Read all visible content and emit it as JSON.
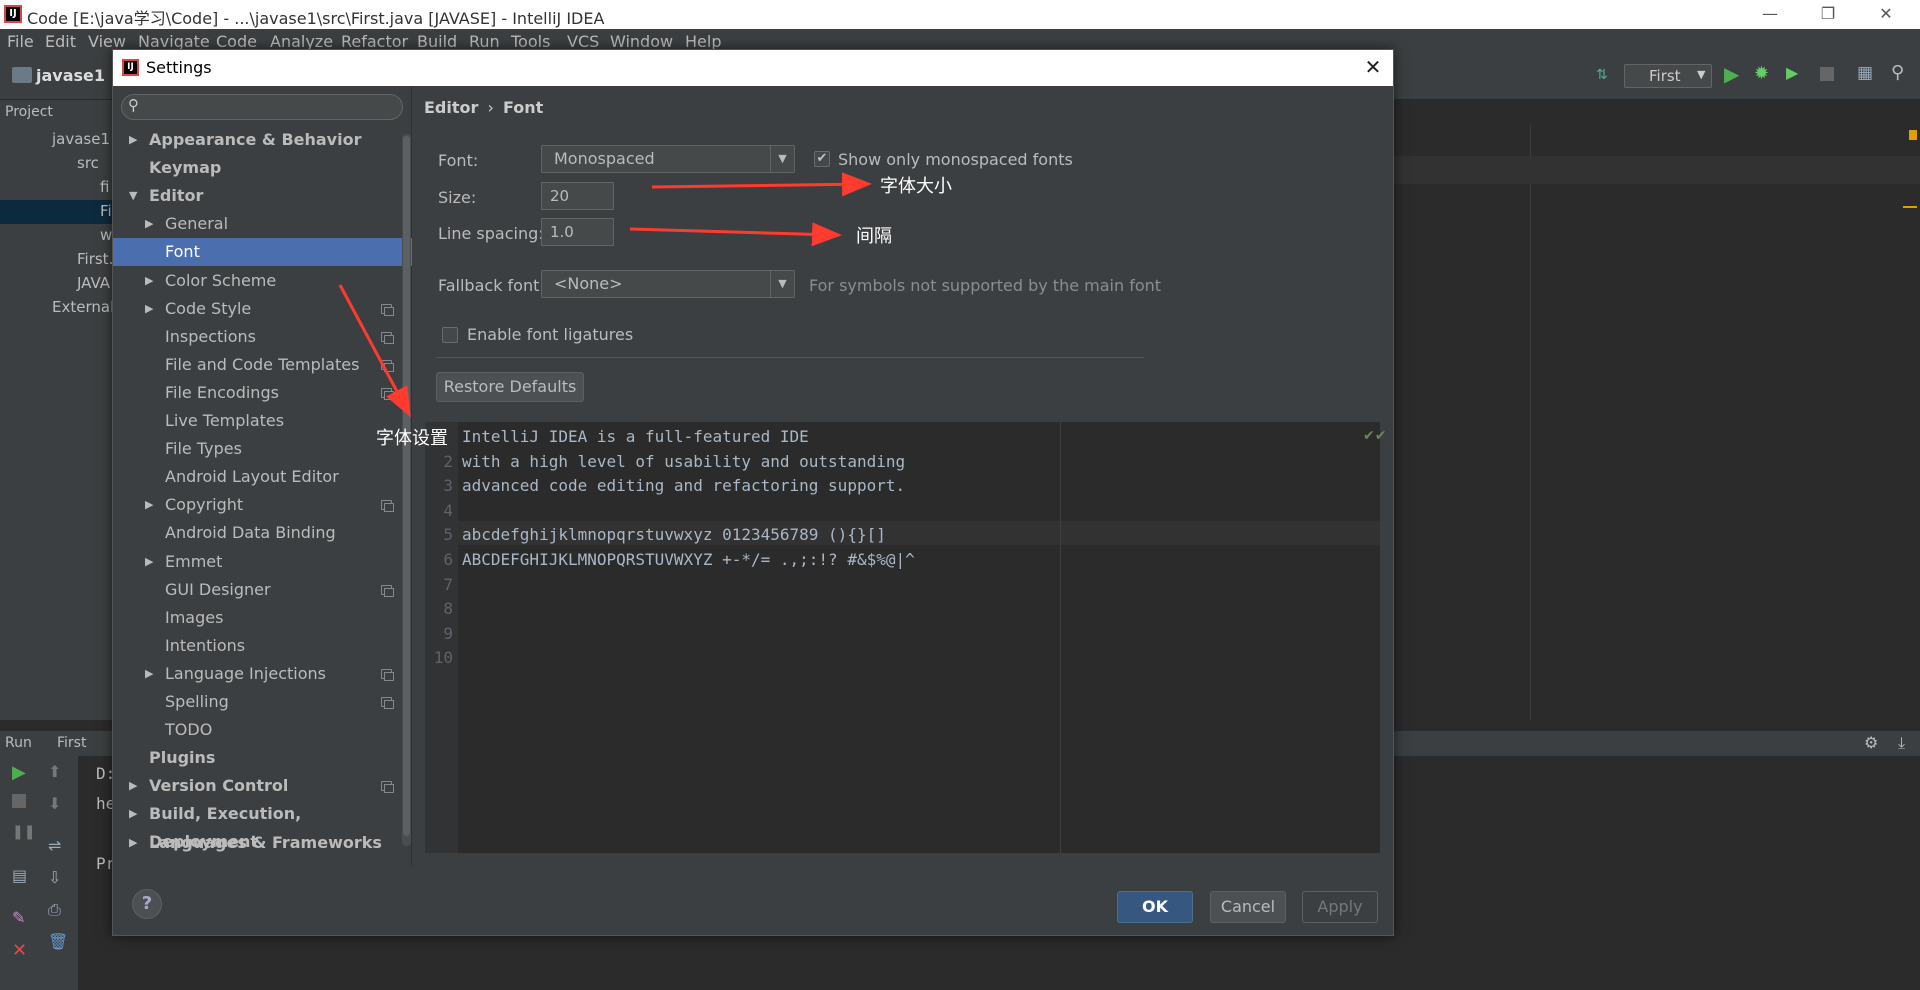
{
  "window": {
    "title": "Code [E:\\java学习\\Code] - ...\\javase1\\src\\First.java [JAVASE] - IntelliJ IDEA"
  },
  "menu": [
    "File",
    "Edit",
    "View",
    "Navigate",
    "Code",
    "Analyze",
    "Refactor",
    "Build",
    "Run",
    "Tools",
    "VCS",
    "Window",
    "Help"
  ],
  "toolbar": {
    "project": "javase1",
    "run_config": "First"
  },
  "project_panel": {
    "tab": "Project",
    "items": [
      "javase1",
      "src",
      "fi",
      "Fi",
      "w",
      "First.",
      "JAVA",
      "External"
    ]
  },
  "run_panel": {
    "label": "Run",
    "config": "First",
    "lines": [
      "D:",
      "he",
      "Pr"
    ]
  },
  "dialog": {
    "title": "Settings",
    "search": {
      "placeholder": ""
    },
    "breadcrumb": {
      "parent": "Editor",
      "sep": "›",
      "current": "Font"
    },
    "tree": [
      {
        "label": "Appearance & Behavior",
        "level": 0,
        "bold": true,
        "arrow": "▶"
      },
      {
        "label": "Keymap",
        "level": 0,
        "bold": true,
        "arrow": ""
      },
      {
        "label": "Editor",
        "level": 0,
        "bold": true,
        "arrow": "▼"
      },
      {
        "label": "General",
        "level": 1,
        "arrow": "▶"
      },
      {
        "label": "Font",
        "level": 1,
        "arrow": "",
        "selected": true
      },
      {
        "label": "Color Scheme",
        "level": 1,
        "arrow": "▶"
      },
      {
        "label": "Code Style",
        "level": 1,
        "arrow": "▶",
        "copy": true
      },
      {
        "label": "Inspections",
        "level": 1,
        "arrow": "",
        "copy": true
      },
      {
        "label": "File and Code Templates",
        "level": 1,
        "arrow": "",
        "copy": true
      },
      {
        "label": "File Encodings",
        "level": 1,
        "arrow": "",
        "copy": true
      },
      {
        "label": "Live Templates",
        "level": 1,
        "arrow": ""
      },
      {
        "label": "File Types",
        "level": 1,
        "arrow": ""
      },
      {
        "label": "Android Layout Editor",
        "level": 1,
        "arrow": ""
      },
      {
        "label": "Copyright",
        "level": 1,
        "arrow": "▶",
        "copy": true
      },
      {
        "label": "Android Data Binding",
        "level": 1,
        "arrow": ""
      },
      {
        "label": "Emmet",
        "level": 1,
        "arrow": "▶"
      },
      {
        "label": "GUI Designer",
        "level": 1,
        "arrow": "",
        "copy": true
      },
      {
        "label": "Images",
        "level": 1,
        "arrow": ""
      },
      {
        "label": "Intentions",
        "level": 1,
        "arrow": ""
      },
      {
        "label": "Language Injections",
        "level": 1,
        "arrow": "▶",
        "copy": true
      },
      {
        "label": "Spelling",
        "level": 1,
        "arrow": "",
        "copy": true
      },
      {
        "label": "TODO",
        "level": 1,
        "arrow": ""
      },
      {
        "label": "Plugins",
        "level": 0,
        "bold": true,
        "arrow": ""
      },
      {
        "label": "Version Control",
        "level": 0,
        "bold": true,
        "arrow": "▶",
        "copy": true
      },
      {
        "label": "Build, Execution, Deployment",
        "level": 0,
        "bold": true,
        "arrow": "▶"
      },
      {
        "label": "Languages & Frameworks",
        "level": 0,
        "bold": true,
        "arrow": "▶"
      }
    ],
    "font": {
      "font_label": "Font:",
      "font_value": "Monospaced",
      "mono_only_label": "Show only monospaced fonts",
      "mono_only_checked": true,
      "size_label": "Size:",
      "size_value": "20",
      "spacing_label": "Line spacing:",
      "spacing_value": "1.0",
      "fallback_label": "Fallback font:",
      "fallback_value": "<None>",
      "fallback_hint": "For symbols not supported by the main font",
      "ligatures_label": "Enable font ligatures",
      "ligatures_checked": false,
      "restore_label": "Restore Defaults"
    },
    "preview": [
      {
        "n": "",
        "text": "IntelliJ IDEA is a full-featured IDE"
      },
      {
        "n": "2",
        "text": "with a high level of usability and outstanding"
      },
      {
        "n": "3",
        "text": "advanced code editing and refactoring support."
      },
      {
        "n": "4",
        "text": ""
      },
      {
        "n": "5",
        "text": "abcdefghijklmnopqrstuvwxyz 0123456789 (){}[]"
      },
      {
        "n": "6",
        "text": "ABCDEFGHIJKLMNOPQRSTUVWXYZ +-*/= .,;:!? #&$%@|^"
      },
      {
        "n": "7",
        "text": ""
      },
      {
        "n": "8",
        "text": ""
      },
      {
        "n": "9",
        "text": ""
      },
      {
        "n": "10",
        "text": ""
      }
    ],
    "buttons": {
      "ok": "OK",
      "cancel": "Cancel",
      "apply": "Apply",
      "help": "?"
    }
  },
  "annotations": {
    "size": "字体大小",
    "spacing": "间隔",
    "font_setting": "字体设置"
  },
  "colors": {
    "selection": "#4b6eaf",
    "arrow": "#ff3b30",
    "ok_button": "#365880"
  }
}
